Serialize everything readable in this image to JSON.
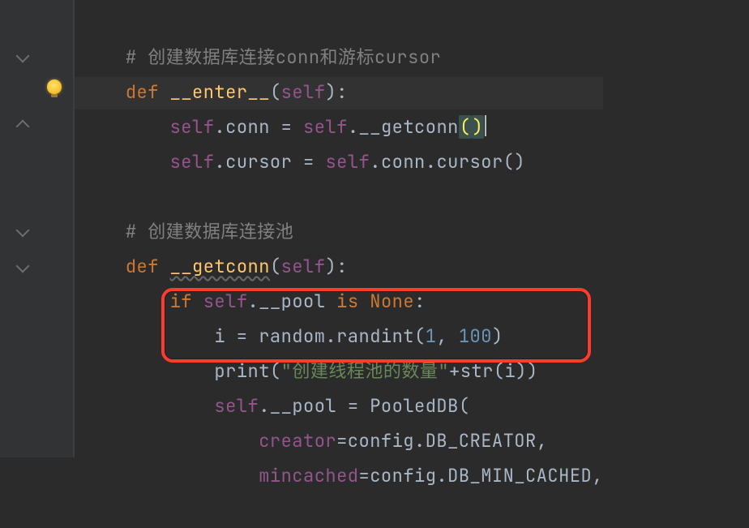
{
  "code": {
    "c1": "# 创建数据库连接conn和游标cursor",
    "kw_def1": "def",
    "fn_enter": "__enter__",
    "self1": "self",
    "self2": "self",
    "attr_conn": ".conn = ",
    "self3": "self",
    "call_getconn": ".__getconn",
    "paren_open": "(",
    "paren_close": ")",
    "self4": "self",
    "attr_cursor": ".cursor = ",
    "self5": "self",
    "chain_cursor": ".conn.cursor()",
    "c2": "# 创建数据库连接池",
    "kw_def2": "def",
    "fn_getconn": "__getconn",
    "self6": "self",
    "kw_if": "if",
    "self7": "self",
    "pool_attr": ".__pool ",
    "kw_is": "is",
    "kw_none": " None",
    "i_eq": "i = random.randint(",
    "n1": "1",
    "comma": ", ",
    "n100": "100",
    "rand_close": ")",
    "print_kw": "print",
    "print_open": "(",
    "str_lit": "\"创建线程池的数量\"",
    "plus": "+",
    "str_call": "str",
    "str_open": "(i))",
    "self8": "self",
    "pool_assign": ".__pool = PooledDB(",
    "kwarg1": "creator",
    "kwarg1v": "=config.DB_CREATOR,",
    "kwarg2": "mincached",
    "kwarg2v": "=config.DB_MIN_CACHED,"
  },
  "icons": {
    "bulb": "intention-bulb"
  }
}
